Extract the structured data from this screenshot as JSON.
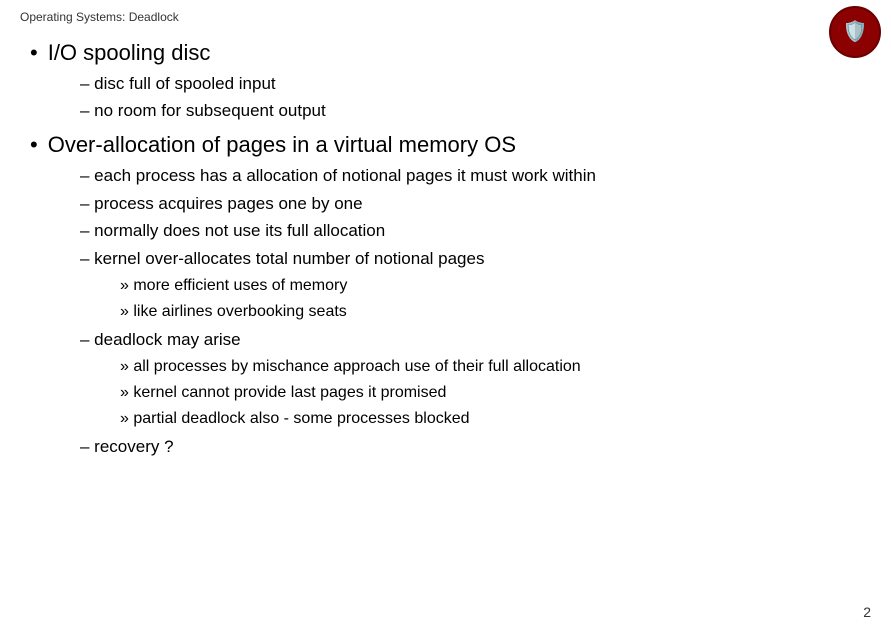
{
  "header": {
    "title": "Operating Systems: Deadlock"
  },
  "slide": {
    "bullets": [
      {
        "id": "b1",
        "level": 1,
        "text": "I/O spooling disc"
      },
      {
        "id": "b1-1",
        "level": 2,
        "text": "– disc full of spooled input"
      },
      {
        "id": "b1-2",
        "level": 2,
        "text": "– no room for subsequent output"
      },
      {
        "id": "b2",
        "level": 1,
        "text": "Over-allocation of pages in a virtual memory OS"
      },
      {
        "id": "b2-1",
        "level": 2,
        "text": "– each process has a allocation of notional pages it must work within"
      },
      {
        "id": "b2-2",
        "level": 2,
        "text": "– process acquires pages one by one"
      },
      {
        "id": "b2-3",
        "level": 2,
        "text": "– normally does not use its full allocation"
      },
      {
        "id": "b2-4",
        "level": 2,
        "text": "– kernel over-allocates total number of notional pages"
      },
      {
        "id": "b2-4-1",
        "level": 3,
        "text": "» more efficient uses of memory"
      },
      {
        "id": "b2-4-2",
        "level": 3,
        "text": "» like airlines overbooking seats"
      },
      {
        "id": "b2-5",
        "level": 2,
        "text": "– deadlock may arise"
      },
      {
        "id": "b2-5-1",
        "level": 3,
        "text": "» all processes by mischance approach use of their full allocation"
      },
      {
        "id": "b2-5-2",
        "level": 3,
        "text": "» kernel cannot provide last pages it promised"
      },
      {
        "id": "b2-5-3",
        "level": 3,
        "text": "» partial deadlock also - some processes blocked"
      },
      {
        "id": "b2-6",
        "level": 2,
        "text": "– recovery ?"
      }
    ]
  },
  "page_number": "2"
}
